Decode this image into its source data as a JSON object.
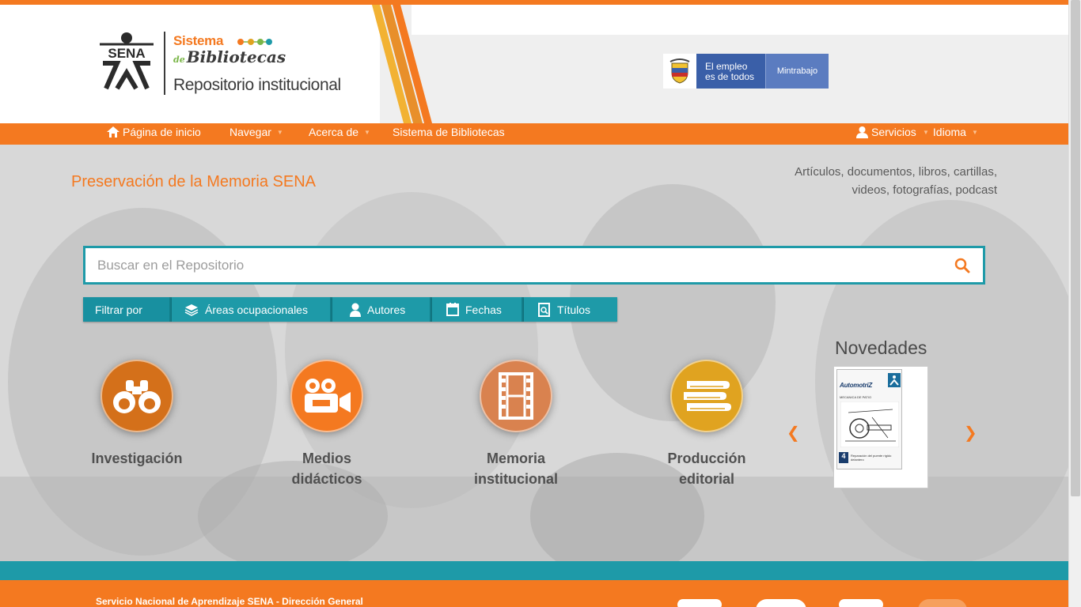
{
  "header": {
    "logo_text": "SENA",
    "sistema_label": "Sistema",
    "bibliotecas_prefix": "de",
    "bibliotecas_label": "Bibliotecas",
    "repo_title": "Repositorio institucional",
    "gov_banner": {
      "slogan_line1": "El empleo",
      "slogan_line2": "es de todos",
      "ministry": "Mintrabajo"
    }
  },
  "nav": {
    "home": "Página de inicio",
    "navegar": "Navegar",
    "acerca": "Acerca de",
    "sistema": "Sistema de Bibliotecas",
    "servicios": "Servicios",
    "idioma": "Idioma"
  },
  "hero": {
    "tagline_left": "Preservación de la Memoria SENA",
    "tagline_right_line1": "Artículos, documentos, libros, cartillas,",
    "tagline_right_line2": "videos, fotografías, podcast"
  },
  "search": {
    "placeholder": "Buscar en el Repositorio",
    "value": ""
  },
  "filters": {
    "label": "Filtrar por",
    "items": [
      {
        "label": "Áreas ocupacionales",
        "icon": "stack-icon"
      },
      {
        "label": "Autores",
        "icon": "user-icon"
      },
      {
        "label": "Fechas",
        "icon": "calendar-icon"
      },
      {
        "label": "Títulos",
        "icon": "search-doc-icon"
      }
    ]
  },
  "categories": [
    {
      "line1": "Investigación",
      "line2": "",
      "icon": "binoculars-icon",
      "color": "#d4701a"
    },
    {
      "line1": "Medios",
      "line2": "didácticos",
      "icon": "video-camera-icon",
      "color": "#f47920"
    },
    {
      "line1": "Memoria",
      "line2": "institucional",
      "icon": "film-icon",
      "color": "#d9824f"
    },
    {
      "line1": "Producción",
      "line2": "editorial",
      "icon": "books-icon",
      "color": "#e0a320"
    }
  ],
  "novedades": {
    "title": "Novedades",
    "cover_title": "AutomotriZ",
    "cover_subtitle": "MECANICA DE PATIO",
    "cover_number": "4",
    "cover_footer": "Reparación del puente rígido delantero"
  },
  "footer": {
    "text": "Servicio Nacional de Aprendizaje SENA - Dirección General"
  },
  "colors": {
    "orange": "#f47920",
    "teal": "#1e9aa8",
    "dark_gray": "#3b3b3b"
  }
}
